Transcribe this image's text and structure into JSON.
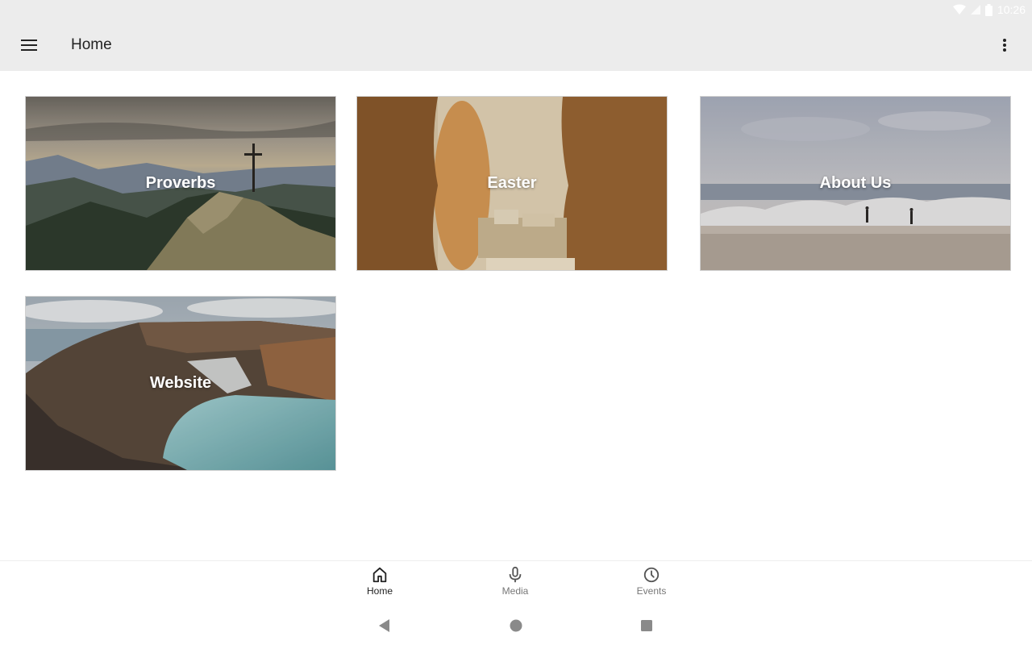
{
  "status_bar": {
    "time": "10:26"
  },
  "app_bar": {
    "title": "Home",
    "menu_icon": "hamburger-menu-icon",
    "overflow_icon": "more-vert-icon"
  },
  "tiles": [
    {
      "label": "Proverbs",
      "image": "mountain-cross-photo"
    },
    {
      "label": "Easter",
      "image": "empty-tomb-photo"
    },
    {
      "label": "About Us",
      "image": "beach-waves-photo"
    },
    {
      "label": "Website",
      "image": "crater-lake-photo"
    }
  ],
  "bottom_nav": {
    "items": [
      {
        "label": "Home",
        "icon": "home-icon",
        "active": true
      },
      {
        "label": "Media",
        "icon": "microphone-icon",
        "active": false
      },
      {
        "label": "Events",
        "icon": "clock-icon",
        "active": false
      }
    ]
  },
  "colors": {
    "app_bar_bg": "#ececec",
    "active_nav": "#222222",
    "inactive_nav": "#777777"
  }
}
